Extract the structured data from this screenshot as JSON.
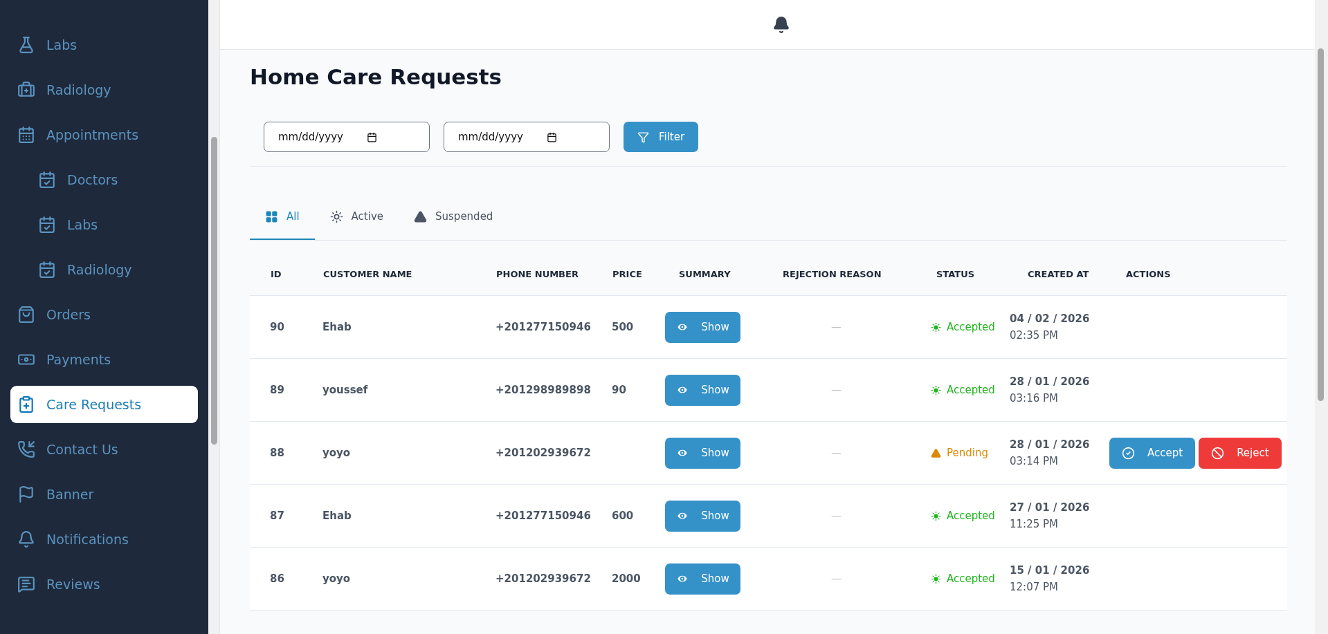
{
  "sidebar": {
    "items": [
      {
        "label": "Labs",
        "selected": false
      },
      {
        "label": "Radiology",
        "selected": false
      },
      {
        "label": "Appointments",
        "selected": false,
        "children": [
          {
            "label": "Doctors",
            "selected": false
          },
          {
            "label": "Labs",
            "selected": false
          },
          {
            "label": "Radiology",
            "selected": false
          }
        ]
      },
      {
        "label": "Orders",
        "selected": false
      },
      {
        "label": "Payments",
        "selected": false
      },
      {
        "label": "Care Requests",
        "selected": true
      },
      {
        "label": "Contact Us",
        "selected": false
      },
      {
        "label": "Banner",
        "selected": false
      },
      {
        "label": "Notifications",
        "selected": false
      },
      {
        "label": "Reviews",
        "selected": false
      }
    ]
  },
  "page": {
    "title": "Home Care Requests"
  },
  "filters": {
    "date_from": {
      "placeholder": "mm/dd/yyyy"
    },
    "date_to": {
      "placeholder": "mm/dd/yyyy"
    },
    "button": "Filter"
  },
  "tabs": [
    {
      "label": "All",
      "selected": true
    },
    {
      "label": "Active",
      "selected": false
    },
    {
      "label": "Suspended",
      "selected": false
    }
  ],
  "table": {
    "columns": [
      "ID",
      "CUSTOMER NAME",
      "PHONE NUMBER",
      "PRICE",
      "SUMMARY",
      "REJECTION REASON",
      "STATUS",
      "CREATED AT",
      "ACTIONS"
    ],
    "rows": [
      {
        "id": "90",
        "customer": "Ehab",
        "phone": "+201277150946",
        "price": "500",
        "summary": "Show",
        "rejection_reason": "—",
        "status": {
          "kind": "accepted",
          "label": "Accepted"
        },
        "date": "04 / 02 / 2026",
        "time": "02:35 PM"
      },
      {
        "id": "89",
        "customer": "youssef",
        "phone": "+201298989898",
        "price": "90",
        "summary": "Show",
        "rejection_reason": "—",
        "status": {
          "kind": "accepted",
          "label": "Accepted"
        },
        "date": "28 / 01 / 2026",
        "time": "03:16 PM"
      },
      {
        "id": "88",
        "customer": "yoyo",
        "phone": "+201202939672",
        "summary": "Show",
        "rejection_reason": "—",
        "status": {
          "kind": "pending",
          "label": "Pending"
        },
        "date": "28 / 01 / 2026",
        "time": "03:14 PM",
        "actions": [
          {
            "kind": "accept",
            "label": "Accept"
          },
          {
            "kind": "reject",
            "label": "Reject"
          }
        ]
      },
      {
        "id": "87",
        "customer": "Ehab",
        "phone": "+201277150946",
        "price": "600",
        "summary": "Show",
        "rejection_reason": "—",
        "status": {
          "kind": "accepted",
          "label": "Accepted"
        },
        "date": "27 / 01 / 2026",
        "time": "11:25 PM"
      },
      {
        "id": "86",
        "customer": "yoyo",
        "phone": "+201202939672",
        "price": "2000",
        "summary": "Show",
        "rejection_reason": "—",
        "status": {
          "kind": "accepted",
          "label": "Accepted"
        },
        "date": "15 / 01 / 2026",
        "time": "12:07 PM"
      }
    ]
  }
}
